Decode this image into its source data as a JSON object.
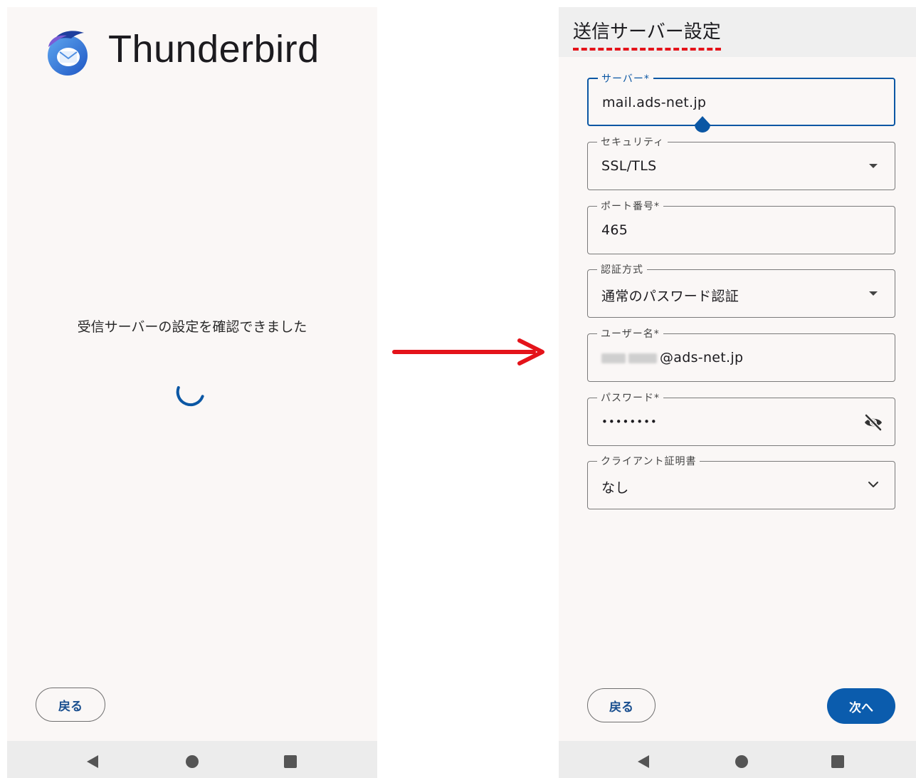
{
  "left_screen": {
    "app_name": "Thunderbird",
    "status_message": "受信サーバーの設定を確認できました",
    "back_label": "戻る"
  },
  "right_screen": {
    "title": "送信サーバー設定",
    "fields": {
      "server": {
        "label": "サーバー*",
        "value": "mail.ads-net.jp"
      },
      "security": {
        "label": "セキュリティ",
        "value": "SSL/TLS"
      },
      "port": {
        "label": "ポート番号*",
        "value": "465"
      },
      "auth": {
        "label": "認証方式",
        "value": "通常のパスワード認証"
      },
      "username": {
        "label": "ユーザー名*",
        "value": "@ads-net.jp"
      },
      "password": {
        "label": "パスワード*",
        "value": "••••••••"
      },
      "client_cert": {
        "label": "クライアント証明書",
        "value": "なし"
      }
    },
    "back_label": "戻る",
    "next_label": "次へ"
  },
  "colors": {
    "accent": "#0b5cad",
    "arrow": "#e4131a",
    "background": "#faf7f6"
  },
  "icons": [
    "thunderbird-logo",
    "loading-spinner",
    "arrow-right",
    "dropdown-caret",
    "chevron-down",
    "eye-off-icon",
    "nav-back",
    "nav-home",
    "nav-recent"
  ]
}
